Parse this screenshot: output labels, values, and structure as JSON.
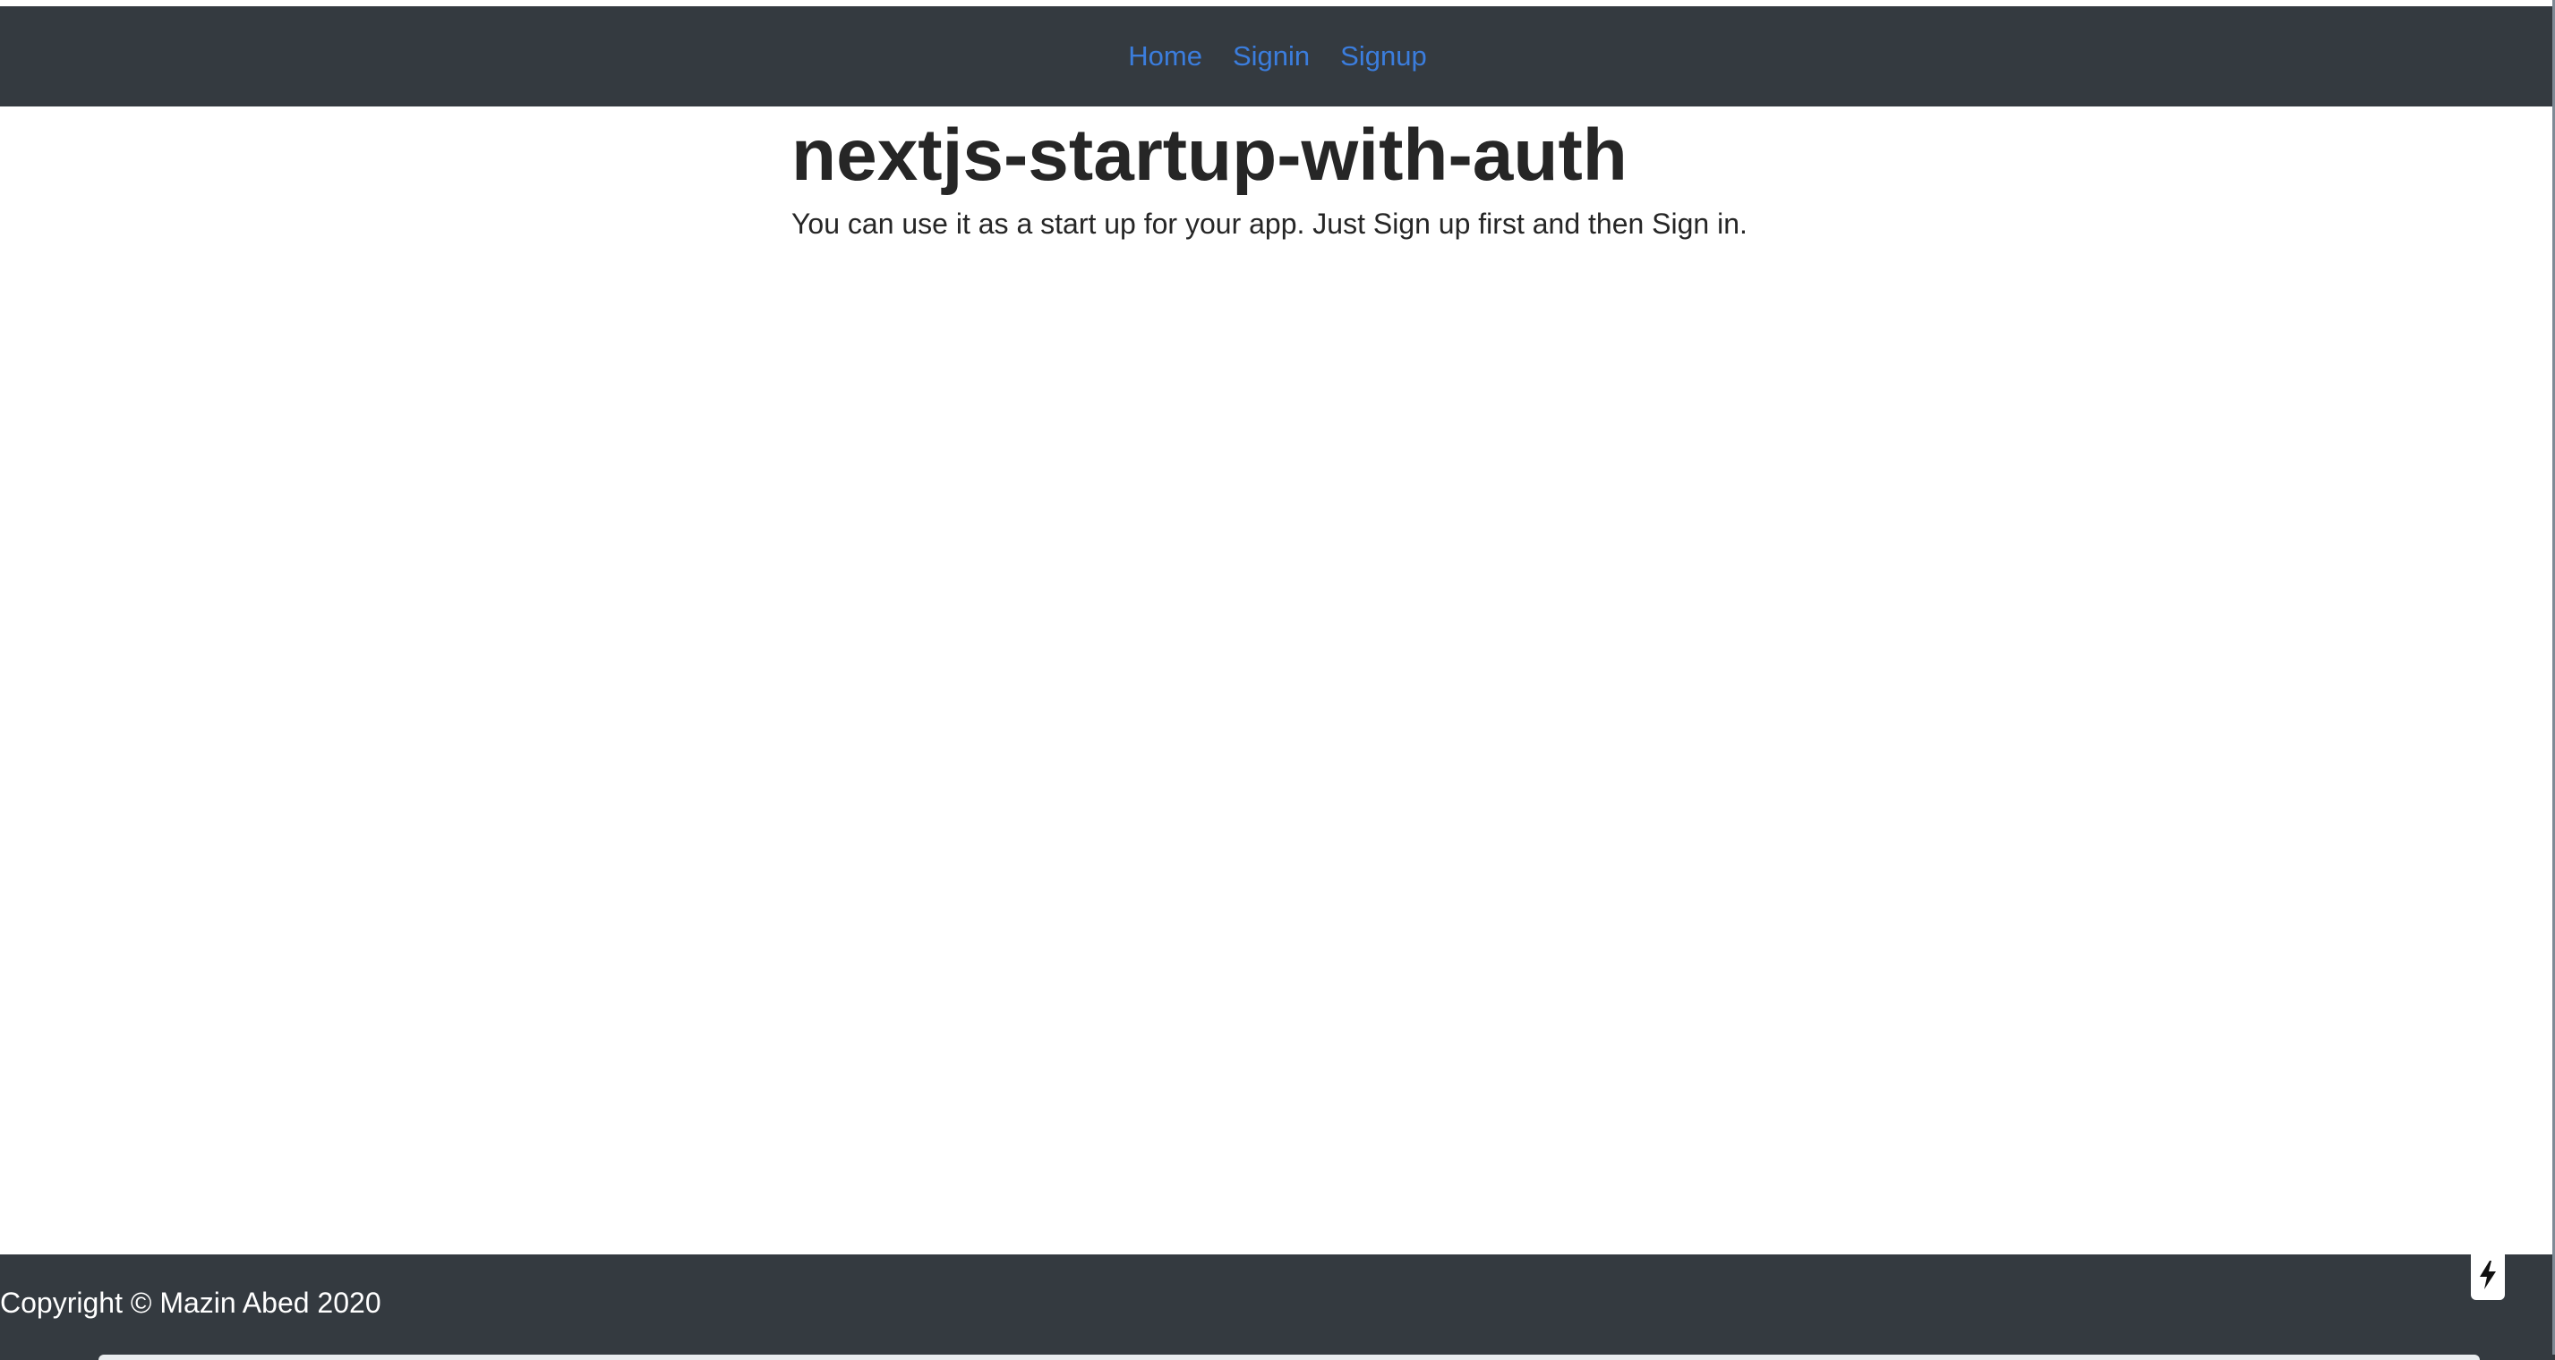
{
  "nav": {
    "items": [
      {
        "label": "Home"
      },
      {
        "label": "Signin"
      },
      {
        "label": "Signup"
      }
    ]
  },
  "main": {
    "title": "nextjs-startup-with-auth",
    "description": "You can use it as a start up for your app. Just Sign up first and then Sign in."
  },
  "footer": {
    "copyright": "Copyright © Mazin Abed 2020"
  },
  "colors": {
    "navbar_bg": "#343a40",
    "link": "#3b7ddd",
    "text": "#262626",
    "footer_text": "#ffffff"
  },
  "icons": {
    "dev_indicator": "lightning-bolt-icon"
  }
}
